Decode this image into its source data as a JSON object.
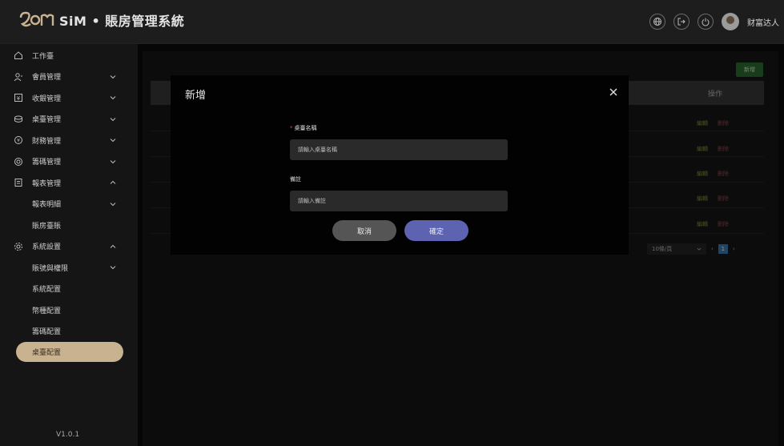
{
  "header": {
    "app_title": "SiM • 賬房管理系統",
    "username": "财富达人",
    "icons": [
      "globe-icon",
      "logout-icon",
      "power-icon"
    ]
  },
  "sidebar": {
    "items": [
      {
        "label": "工作臺",
        "icon": "home-icon"
      },
      {
        "label": "會員管理",
        "icon": "users-icon",
        "chevron": "down"
      },
      {
        "label": "收銀管理",
        "icon": "yen-icon",
        "chevron": "down"
      },
      {
        "label": "桌臺管理",
        "icon": "table-icon",
        "chevron": "down"
      },
      {
        "label": "財務管理",
        "icon": "finance-icon",
        "chevron": "down"
      },
      {
        "label": "籌碼管理",
        "icon": "chip-icon",
        "chevron": "down"
      },
      {
        "label": "報表管理",
        "icon": "report-icon",
        "chevron": "up"
      },
      {
        "label": "報表明細",
        "sub": true,
        "chevron": "down"
      },
      {
        "label": "賬房臺賬",
        "sub": true
      },
      {
        "label": "系統設置",
        "icon": "settings-icon",
        "chevron": "up"
      },
      {
        "label": "賬號與權限",
        "sub": true,
        "chevron": "down"
      },
      {
        "label": "系統配置",
        "sub": true
      },
      {
        "label": "幣種配置",
        "sub": true
      },
      {
        "label": "籌碼配置",
        "sub": true
      },
      {
        "label": "桌臺配置",
        "sub": true,
        "active": true
      }
    ],
    "version": "V1.0.1"
  },
  "page": {
    "add_label": "新增",
    "action_header": "操作",
    "rows": [
      {
        "edit": "編輯",
        "delete": "刪除"
      },
      {
        "edit": "編輯",
        "delete": "刪除"
      },
      {
        "edit": "編輯",
        "delete": "刪除"
      },
      {
        "edit": "編輯",
        "delete": "刪除"
      },
      {
        "edit": "編輯",
        "delete": "刪除"
      }
    ],
    "pagination": {
      "page_size": "10條/頁",
      "current_page": "1"
    }
  },
  "modal": {
    "title": "新增",
    "table_name_label": "桌臺名稱",
    "table_name_placeholder": "請輸入桌臺名稱",
    "table_name_value": "",
    "remark_label": "備註",
    "remark_placeholder": "請輸入備註",
    "remark_value": "",
    "cancel_label": "取消",
    "confirm_label": "確定"
  },
  "colors": {
    "accent_active": "#c9b28f",
    "confirm_button": "#5d63b0",
    "add_button": "#2e6e33",
    "edit_link": "#8a9a3a",
    "delete_link": "#9a4a55",
    "required_star": "#d94444"
  }
}
